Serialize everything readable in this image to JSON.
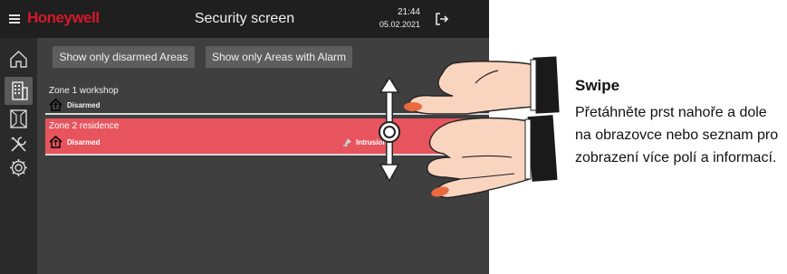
{
  "header": {
    "menu_icon": "hamburger-icon",
    "brand": "Honeywell",
    "title": "Security screen",
    "time": "21:44",
    "date": "05.02.2021",
    "logout_icon": "logout-icon"
  },
  "sidebar": {
    "items": [
      {
        "icon": "home-icon"
      },
      {
        "icon": "building-icon",
        "active": true
      },
      {
        "icon": "door-icon"
      },
      {
        "icon": "tools-icon"
      },
      {
        "icon": "gear-icon"
      }
    ]
  },
  "filters": {
    "disarmed_label": "Show only disarmed Areas",
    "alarm_label": "Show only Areas with Alarm"
  },
  "zones": [
    {
      "name": "Zone 1 workshop",
      "status": "Disarmed",
      "alarm": "",
      "state": "normal"
    },
    {
      "name": "Zone 2 residence",
      "status": "Disarmed",
      "alarm": "Intrusion",
      "state": "alarm"
    }
  ],
  "instruction": {
    "title": "Swipe",
    "text": "Přetáhněte prst nahoře a dole na obrazovce nebo seznam pro zobrazení více polí a informací."
  },
  "colors": {
    "brand": "#d6182a",
    "alarm_row": "#e8545d",
    "screen_bg": "#3f3f3f",
    "topbar_bg": "#1f1f1f"
  }
}
